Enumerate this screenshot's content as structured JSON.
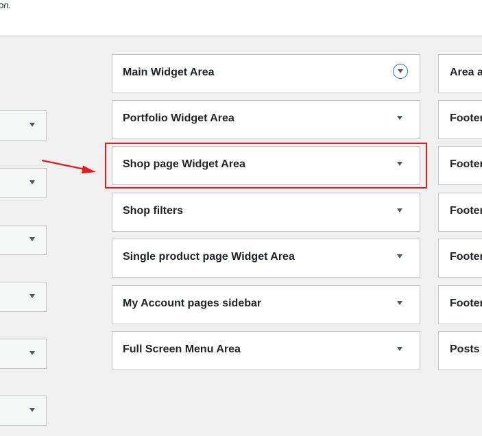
{
  "header": {
    "fragment_text": "on."
  },
  "left_widgets": {
    "count": 6,
    "caret_icon": "caret-down-icon"
  },
  "sidebars": [
    {
      "label": "Main Widget Area",
      "expanded_hover": true
    },
    {
      "label": "Portfolio Widget Area"
    },
    {
      "label": "Shop page Widget Area",
      "highlighted": true
    },
    {
      "label": "Shop filters"
    },
    {
      "label": "Single product page Widget Area"
    },
    {
      "label": "My Account pages sidebar"
    },
    {
      "label": "Full Screen Menu Area"
    }
  ],
  "right_sidebars": [
    {
      "label": "Area a"
    },
    {
      "label": "Footer"
    },
    {
      "label": "Footer"
    },
    {
      "label": "Footer"
    },
    {
      "label": "Footer"
    },
    {
      "label": "Footer"
    },
    {
      "label": "Posts"
    }
  ],
  "annotation": {
    "highlight_color": "#e8191f",
    "arrow_icon": "red-arrow-icon"
  },
  "colors": {
    "background": "#f0f0f1",
    "card_border": "#c3c4c7",
    "accent_blue": "#2271b1"
  }
}
